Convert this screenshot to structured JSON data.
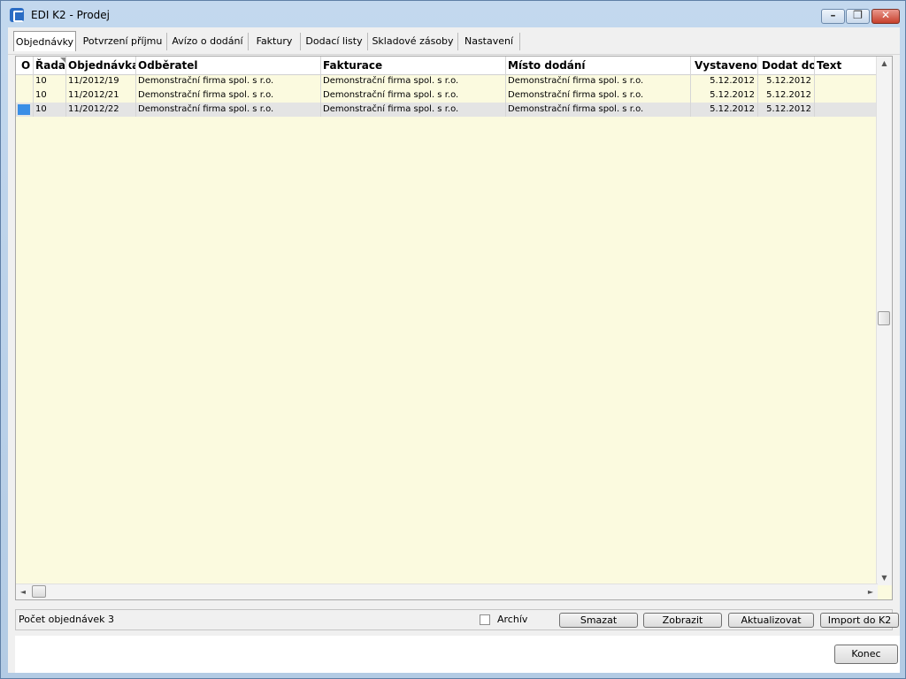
{
  "window": {
    "title": "EDI K2 - Prodej",
    "minimize": "–",
    "restore": "❐",
    "close": "✕"
  },
  "tabs": [
    {
      "label": "Objednávky",
      "active": true
    },
    {
      "label": "Potvrzení příjmu"
    },
    {
      "label": "Avízo o dodání"
    },
    {
      "label": "Faktury"
    },
    {
      "label": "Dodací listy"
    },
    {
      "label": "Skladové zásoby"
    },
    {
      "label": "Nastavení"
    }
  ],
  "grid": {
    "columns": [
      "O",
      "Řada",
      "Objednávka",
      "Odběratel",
      "Fakturace",
      "Místo dodání",
      "Vystaveno",
      "Dodat do",
      "Text"
    ],
    "rows": [
      [
        "",
        "10",
        "11/2012/19",
        "Demonstrační firma spol. s r.o.",
        "Demonstrační firma spol. s r.o.",
        "Demonstrační firma spol. s r.o.",
        "5.12.2012",
        "5.12.2012",
        ""
      ],
      [
        "",
        "10",
        "11/2012/21",
        "Demonstrační firma spol. s r.o.",
        "Demonstrační firma spol. s r.o.",
        "Demonstrační firma spol. s r.o.",
        "5.12.2012",
        "5.12.2012",
        ""
      ],
      [
        "",
        "10",
        "11/2012/22",
        "Demonstrační firma spol. s r.o.",
        "Demonstrační firma spol. s r.o.",
        "Demonstrační firma spol. s r.o.",
        "5.12.2012",
        "5.12.2012",
        ""
      ]
    ]
  },
  "scroll": {
    "up": "▲",
    "down": "▼",
    "left": "◄",
    "right": "►"
  },
  "status": {
    "count_text": "Počet objednávek 3",
    "archive_label": "Archív",
    "archive_checked": false,
    "buttons": {
      "delete": "Smazat",
      "show": "Zobrazit",
      "refresh": "Aktualizovat",
      "import": "Import do K2"
    }
  },
  "footer": {
    "close_button": "Konec"
  }
}
